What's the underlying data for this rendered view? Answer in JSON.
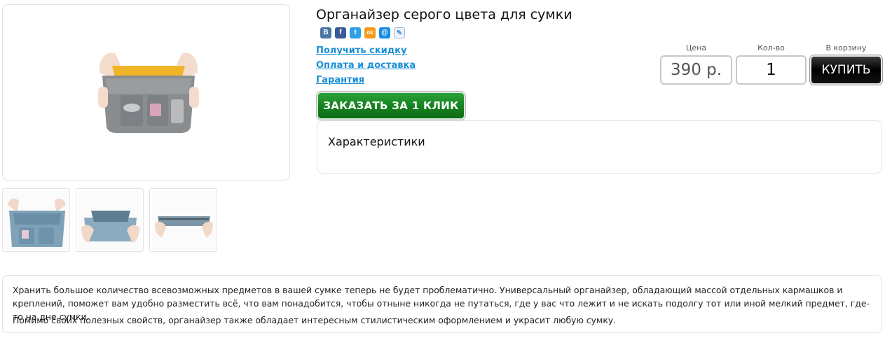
{
  "product": {
    "title": "Органайзер серого цвета для сумки",
    "images": {
      "main_alt": "organizer-photo-main",
      "thumbnails": [
        "organizer-photo-1",
        "organizer-photo-2",
        "organizer-photo-3"
      ]
    }
  },
  "share": {
    "icons": [
      {
        "name": "vk-icon",
        "glyph": "В",
        "color": "#4c75a3"
      },
      {
        "name": "facebook-icon",
        "glyph": "f",
        "color": "#3b5998"
      },
      {
        "name": "twitter-icon",
        "glyph": "t",
        "color": "#2ea0e6"
      },
      {
        "name": "odnoklassniki-icon",
        "glyph": "ok",
        "color": "#f59a1a"
      },
      {
        "name": "mailru-icon",
        "glyph": "@",
        "color": "#168de2"
      },
      {
        "name": "livejournal-icon",
        "glyph": "✎",
        "color": "#4a8ed8"
      }
    ]
  },
  "links": {
    "discount": "Получить скидку",
    "delivery": "Оплата и доставка",
    "warranty": "Гарантия"
  },
  "oneclick": {
    "label": "ЗАКАЗАТЬ ЗА 1 КЛИК"
  },
  "purchase": {
    "price_label": "Цена",
    "qty_label": "Кол-во",
    "cart_label": "В корзину",
    "price_value": "390 р.",
    "qty_value": "1",
    "buy_label": "КУПИТЬ"
  },
  "characteristics": {
    "title": "Характеристики"
  },
  "description": {
    "paragraph1": "Хранить большое количество всевозможных предметов в вашей сумке теперь не будет проблематично. Универсальный органайзер, обладающий массой отдельных кармашков и креплений, поможет вам удобно разместить всё, что вам понадобится, чтобы отныне никогда не путаться, где у вас что лежит и не искать подолгу тот или иной мелкий предмет, где-то на дне сумки.",
    "paragraph2": "Помимо своих полезных свойств, органайзер также обладает интересным стилистическим оформлением и украсит любую сумку."
  },
  "colors": {
    "link": "#1a8fd6",
    "oneclick_green": "#14801e",
    "buy_black": "#000000",
    "border": "#e3e3e3"
  }
}
